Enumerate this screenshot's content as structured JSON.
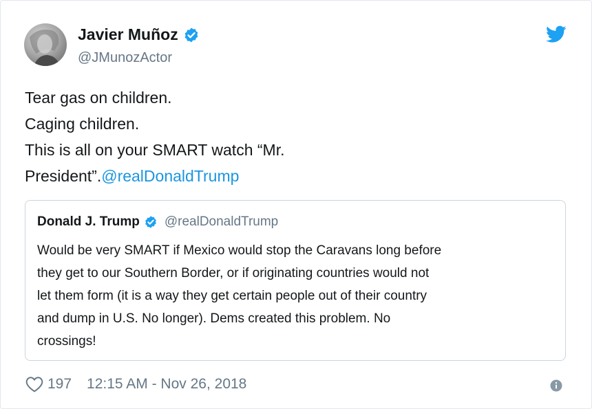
{
  "author": {
    "name": "Javier Muñoz",
    "handle": "@JMunozActor"
  },
  "tweet": {
    "lines": [
      "Tear gas on children.",
      "Caging children.",
      "This is all on your SMART watch “Mr."
    ],
    "last_line_prefix": "President”.",
    "mention": "@realDonaldTrump"
  },
  "quoted_tweet": {
    "name": "Donald J. Trump",
    "handle": "@realDonaldTrump",
    "lines": [
      "Would be very SMART if Mexico would stop the Caravans long before",
      "they get to our Southern Border, or if originating countries would not",
      "let them form (it is a way they get certain people out of their country",
      "and dump in U.S. No longer). Dems created this problem. No",
      "crossings!"
    ]
  },
  "footer": {
    "likes": "197",
    "timestamp": "12:15 AM - Nov 26, 2018"
  },
  "icons": {
    "verified": "verified-badge-icon",
    "twitter": "twitter-bird-icon",
    "like": "heart-icon",
    "info": "info-icon"
  },
  "colors": {
    "accent": "#1da1f2",
    "link": "#1b95e0",
    "secondary_text": "#657786"
  }
}
